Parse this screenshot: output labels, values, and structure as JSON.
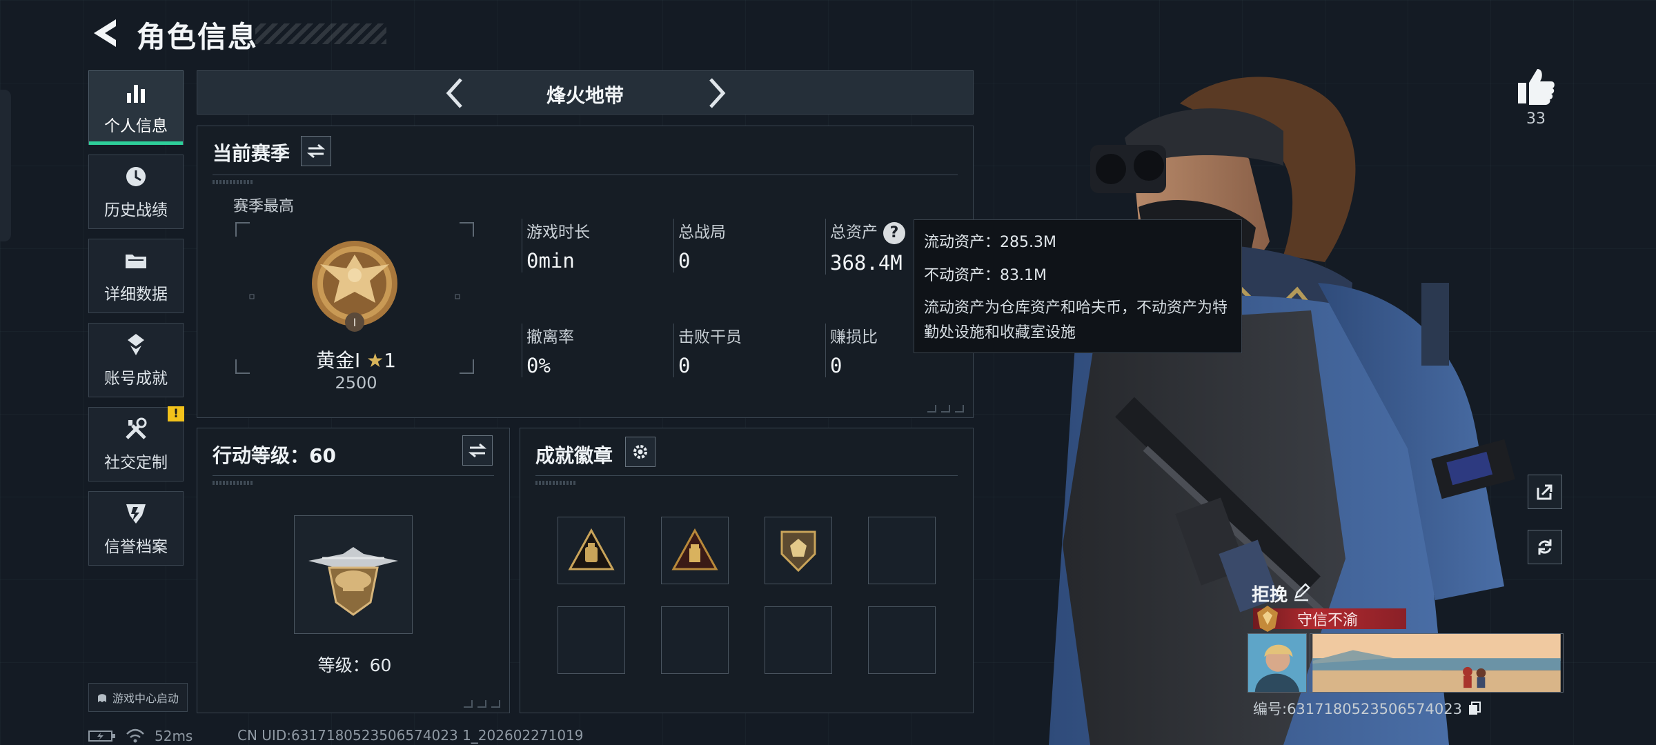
{
  "header": {
    "title": "角色信息"
  },
  "sidebar": {
    "items": [
      {
        "label": "个人信息",
        "icon": "bar-chart-icon",
        "active": true
      },
      {
        "label": "历史战绩",
        "icon": "history-icon"
      },
      {
        "label": "详细数据",
        "icon": "folder-icon"
      },
      {
        "label": "账号成就",
        "icon": "achievement-icon"
      },
      {
        "label": "社交定制",
        "icon": "tools-icon",
        "badge": "!"
      },
      {
        "label": "信誉档案",
        "icon": "shield-icon"
      }
    ],
    "game_center_label": "游戏中心启动"
  },
  "mode": {
    "name": "烽火地带"
  },
  "season": {
    "heading": "当前赛季",
    "best_label": "赛季最高",
    "rank_name": "黄金I",
    "rank_stars": "1",
    "rank_points": "2500",
    "stats": [
      {
        "label": "游戏时长",
        "value": "0min"
      },
      {
        "label": "总战局",
        "value": "0"
      },
      {
        "label": "总资产",
        "value": "368.4M"
      },
      {
        "label": "撤离率",
        "value": "0%"
      },
      {
        "label": "击败干员",
        "value": "0"
      },
      {
        "label": "赚损比",
        "value": "0"
      }
    ]
  },
  "tooltip": {
    "liquid": "流动资产：285.3M",
    "fixed": "不动资产：83.1M",
    "description": "流动资产为仓库资产和哈夫币，不动资产为特勤处设施和收藏室设施"
  },
  "level_panel": {
    "heading": "行动等级：60",
    "level_text": "等级：60"
  },
  "badges_panel": {
    "heading": "成就徽章"
  },
  "player": {
    "likes": "33",
    "name": "拒挽",
    "title": "守信不渝",
    "id_text": "编号:6317180523506574023"
  },
  "status": {
    "ping": "52ms",
    "uid": "CN UID:6317180523506574023 1_202602271019"
  },
  "colors": {
    "accent": "#2ecf9a",
    "warning": "#f2c21b",
    "title_red": "#b02a2f"
  }
}
